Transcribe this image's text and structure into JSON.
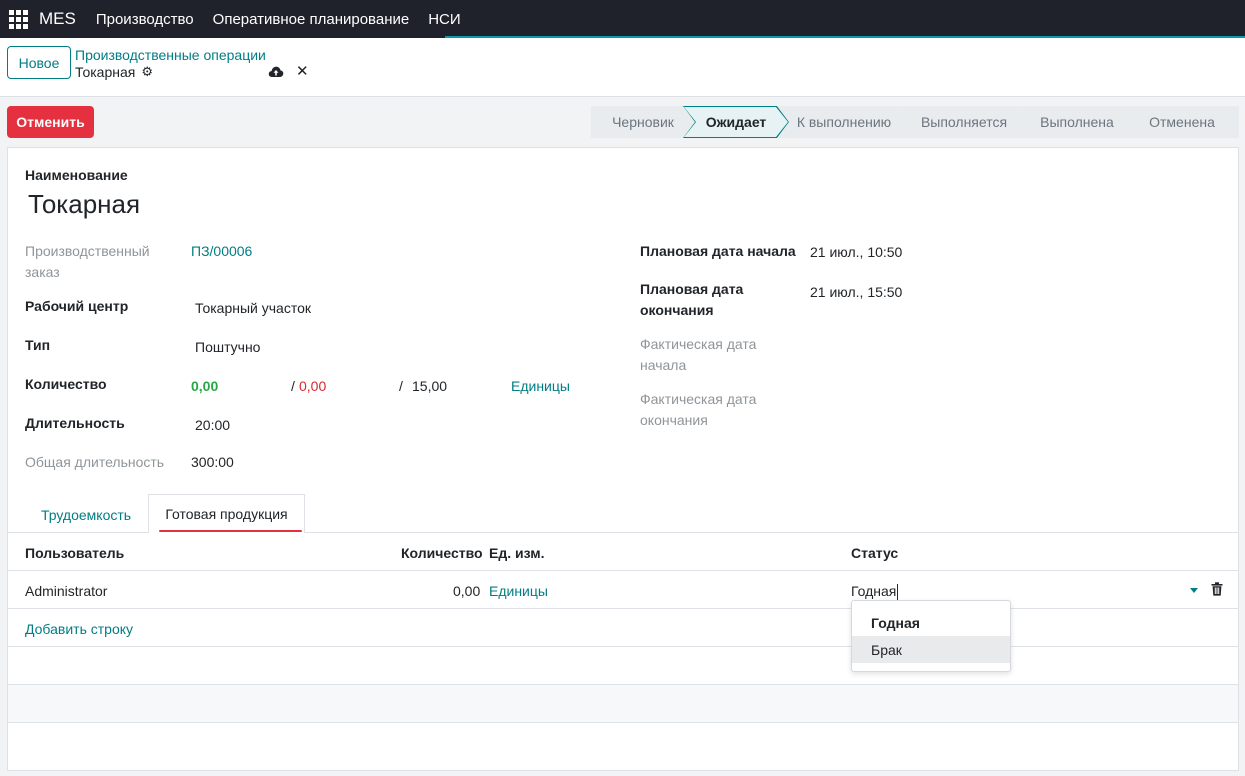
{
  "navbar": {
    "brand": "MES",
    "menu": [
      "Производство",
      "Оперативное планирование",
      "НСИ"
    ],
    "apps_icon": "grid-icon"
  },
  "control": {
    "new_button": "Новое",
    "breadcrumb_parent": "Производственные операции",
    "breadcrumb_current": "Токарная",
    "gear_icon": "gear-icon",
    "save_icon": "cloud-upload-icon",
    "discard_icon": "close-icon"
  },
  "statusbar": {
    "cancel_button": "Отменить",
    "stages": [
      "Черновик",
      "Ожидает",
      "К выполнению",
      "Выполняется",
      "Выполнена",
      "Отменена"
    ],
    "active_stage": "Ожидает"
  },
  "form": {
    "name_label": "Наименование",
    "name_value": "Токарная",
    "order_label": "Производственный заказ",
    "order_value": "ПЗ/00006",
    "workcenter_label": "Рабочий центр",
    "workcenter_value": "Токарный участок",
    "type_label": "Тип",
    "type_value": "Поштучно",
    "qty_label": "Количество",
    "qty_done": "0,00",
    "qty_sep1": "/",
    "qty_scrap": "0,00",
    "qty_sep2": "/",
    "qty_plan": "15,00",
    "qty_uom": "Единицы",
    "duration_label": "Длительность",
    "duration_value": "20:00",
    "total_duration_label": "Общая длительность",
    "total_duration_value": "300:00",
    "plan_start_label": "Плановая дата начала",
    "plan_start_value": "21 июл., 10:50",
    "plan_end_label": "Плановая дата окончания",
    "plan_end_value": "21 июл., 15:50",
    "actual_start_label": "Фактическая дата начала",
    "actual_end_label": "Фактическая дата окончания"
  },
  "tabs": {
    "labor": "Трудоемкость",
    "finished": "Готовая продукция"
  },
  "table": {
    "headers": {
      "user": "Пользователь",
      "qty": "Количество",
      "uom": "Ед. изм.",
      "status": "Статус"
    },
    "row": {
      "user": "Administrator",
      "qty": "0,00",
      "uom": "Единицы",
      "status": "Годная"
    },
    "add_line": "Добавить строку",
    "trash_icon": "trash-icon",
    "caret_icon": "caret-down-icon"
  },
  "dropdown": {
    "options": [
      "Годная",
      "Брак"
    ],
    "selected": "Годная",
    "hovered": "Брак"
  }
}
